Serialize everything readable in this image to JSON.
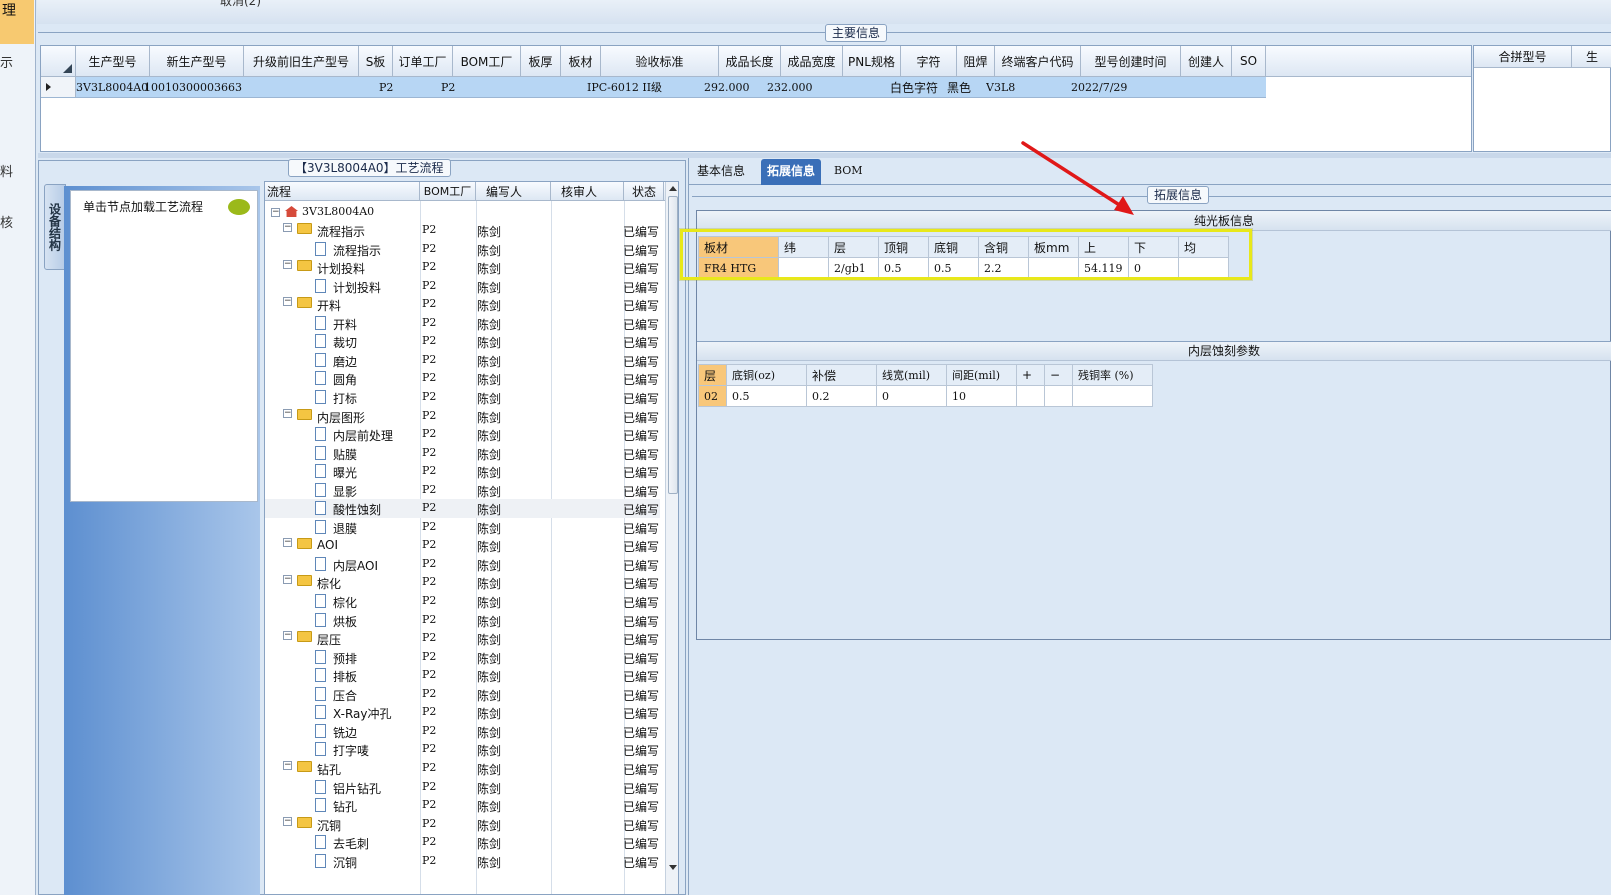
{
  "left_strip": {
    "items": [
      "理",
      "示",
      "料",
      "核"
    ]
  },
  "top_partial": "取消(2)",
  "main_info": {
    "caption": "主要信息",
    "columns": [
      "生产型号",
      "新生产型号",
      "升级前旧生产型号",
      "S板",
      "订单工厂",
      "BOM工厂",
      "板厚",
      "板材",
      "验收标准",
      "成品长度",
      "成品宽度",
      "PNL规格",
      "字符",
      "阻焊",
      "终端客户代码",
      "型号创建时间",
      "创建人",
      "SO"
    ],
    "row": [
      "3V3L8004A0",
      "10010300003663",
      "",
      "",
      "P2",
      "P2",
      "",
      "",
      "IPC-6012 II级",
      "292.000",
      "232.000",
      "",
      "白色字符",
      "黑色",
      "V3L8",
      "2022/7/29",
      "",
      ""
    ],
    "side_columns": [
      "合拼型号",
      "生"
    ]
  },
  "process_panel": {
    "caption": "【3V3L8004A0】工艺流程",
    "vertical_tab": "设备结构",
    "hint": "单击节点加载工艺流程",
    "columns": [
      "流程",
      "BOM工厂",
      "编写人",
      "核审人",
      "状态"
    ],
    "root": "3V3L8004A0",
    "rows": [
      {
        "label": "流程指示",
        "level": 1,
        "folder": true,
        "factory": "P2",
        "writer": "陈剑",
        "status": "已编写"
      },
      {
        "label": "流程指示",
        "level": 2,
        "folder": false,
        "factory": "P2",
        "writer": "陈剑",
        "status": "已编写"
      },
      {
        "label": "计划投料",
        "level": 1,
        "folder": true,
        "factory": "P2",
        "writer": "陈剑",
        "status": "已编写"
      },
      {
        "label": "计划投料",
        "level": 2,
        "folder": false,
        "factory": "P2",
        "writer": "陈剑",
        "status": "已编写"
      },
      {
        "label": "开料",
        "level": 1,
        "folder": true,
        "factory": "P2",
        "writer": "陈剑",
        "status": "已编写"
      },
      {
        "label": "开料",
        "level": 2,
        "folder": false,
        "factory": "P2",
        "writer": "陈剑",
        "status": "已编写"
      },
      {
        "label": "裁切",
        "level": 2,
        "folder": false,
        "factory": "P2",
        "writer": "陈剑",
        "status": "已编写"
      },
      {
        "label": "磨边",
        "level": 2,
        "folder": false,
        "factory": "P2",
        "writer": "陈剑",
        "status": "已编写"
      },
      {
        "label": "圆角",
        "level": 2,
        "folder": false,
        "factory": "P2",
        "writer": "陈剑",
        "status": "已编写"
      },
      {
        "label": "打标",
        "level": 2,
        "folder": false,
        "factory": "P2",
        "writer": "陈剑",
        "status": "已编写"
      },
      {
        "label": "内层图形",
        "level": 1,
        "folder": true,
        "factory": "P2",
        "writer": "陈剑",
        "status": "已编写"
      },
      {
        "label": "内层前处理",
        "level": 2,
        "folder": false,
        "factory": "P2",
        "writer": "陈剑",
        "status": "已编写"
      },
      {
        "label": "贴膜",
        "level": 2,
        "folder": false,
        "factory": "P2",
        "writer": "陈剑",
        "status": "已编写"
      },
      {
        "label": "曝光",
        "level": 2,
        "folder": false,
        "factory": "P2",
        "writer": "陈剑",
        "status": "已编写"
      },
      {
        "label": "显影",
        "level": 2,
        "folder": false,
        "factory": "P2",
        "writer": "陈剑",
        "status": "已编写"
      },
      {
        "label": "酸性蚀刻",
        "level": 2,
        "folder": false,
        "factory": "P2",
        "writer": "陈剑",
        "status": "已编写"
      },
      {
        "label": "退膜",
        "level": 2,
        "folder": false,
        "factory": "P2",
        "writer": "陈剑",
        "status": "已编写"
      },
      {
        "label": "AOI",
        "level": 1,
        "folder": true,
        "factory": "P2",
        "writer": "陈剑",
        "status": "已编写"
      },
      {
        "label": "内层AOI",
        "level": 2,
        "folder": false,
        "factory": "P2",
        "writer": "陈剑",
        "status": "已编写"
      },
      {
        "label": "棕化",
        "level": 1,
        "folder": true,
        "factory": "P2",
        "writer": "陈剑",
        "status": "已编写"
      },
      {
        "label": "棕化",
        "level": 2,
        "folder": false,
        "factory": "P2",
        "writer": "陈剑",
        "status": "已编写"
      },
      {
        "label": "烘板",
        "level": 2,
        "folder": false,
        "factory": "P2",
        "writer": "陈剑",
        "status": "已编写"
      },
      {
        "label": "层压",
        "level": 1,
        "folder": true,
        "factory": "P2",
        "writer": "陈剑",
        "status": "已编写"
      },
      {
        "label": "预排",
        "level": 2,
        "folder": false,
        "factory": "P2",
        "writer": "陈剑",
        "status": "已编写"
      },
      {
        "label": "排板",
        "level": 2,
        "folder": false,
        "factory": "P2",
        "writer": "陈剑",
        "status": "已编写"
      },
      {
        "label": "压合",
        "level": 2,
        "folder": false,
        "factory": "P2",
        "writer": "陈剑",
        "status": "已编写"
      },
      {
        "label": "X-Ray冲孔",
        "level": 2,
        "folder": false,
        "factory": "P2",
        "writer": "陈剑",
        "status": "已编写"
      },
      {
        "label": "铣边",
        "level": 2,
        "folder": false,
        "factory": "P2",
        "writer": "陈剑",
        "status": "已编写"
      },
      {
        "label": "打字唛",
        "level": 2,
        "folder": false,
        "factory": "P2",
        "writer": "陈剑",
        "status": "已编写"
      },
      {
        "label": "钻孔",
        "level": 1,
        "folder": true,
        "factory": "P2",
        "writer": "陈剑",
        "status": "已编写"
      },
      {
        "label": "铝片钻孔",
        "level": 2,
        "folder": false,
        "factory": "P2",
        "writer": "陈剑",
        "status": "已编写"
      },
      {
        "label": "钻孔",
        "level": 2,
        "folder": false,
        "factory": "P2",
        "writer": "陈剑",
        "status": "已编写"
      },
      {
        "label": "沉铜",
        "level": 1,
        "folder": true,
        "factory": "P2",
        "writer": "陈剑",
        "status": "已编写"
      },
      {
        "label": "去毛刺",
        "level": 2,
        "folder": false,
        "factory": "P2",
        "writer": "陈剑",
        "status": "已编写"
      },
      {
        "label": "沉铜",
        "level": 2,
        "folder": false,
        "factory": "P2",
        "writer": "陈剑",
        "status": "已编写"
      }
    ]
  },
  "right_panel": {
    "tabs": [
      "基本信息",
      "拓展信息",
      "BOM"
    ],
    "active_tab": 1,
    "group_caption": "拓展信息",
    "plain_board": {
      "title": "纯光板信息",
      "columns": [
        "板材",
        "纬",
        "层",
        "顶铜",
        "底铜",
        "含铜",
        "板mm",
        "上",
        "下",
        "均"
      ],
      "row": [
        "FR4 HTG",
        "",
        "2/gb1",
        "0.5",
        "0.5",
        "2.2",
        "",
        "54.119",
        "0",
        ""
      ]
    },
    "inner_etch": {
      "title": "内层蚀刻参数",
      "columns": [
        "层",
        "底铜(oz)",
        "补偿",
        "线宽(mil)",
        "间距(mil)",
        "+",
        "−",
        "残铜率 (%)"
      ],
      "row": [
        "02",
        "0.5",
        "0.2",
        "0",
        "10",
        "",
        "",
        ""
      ]
    }
  },
  "colors": {
    "selected_row": "#b7d6f4",
    "highlight_box": "#e8e81a",
    "arrow": "#e01818",
    "active_tab": "#3a6fb8"
  }
}
